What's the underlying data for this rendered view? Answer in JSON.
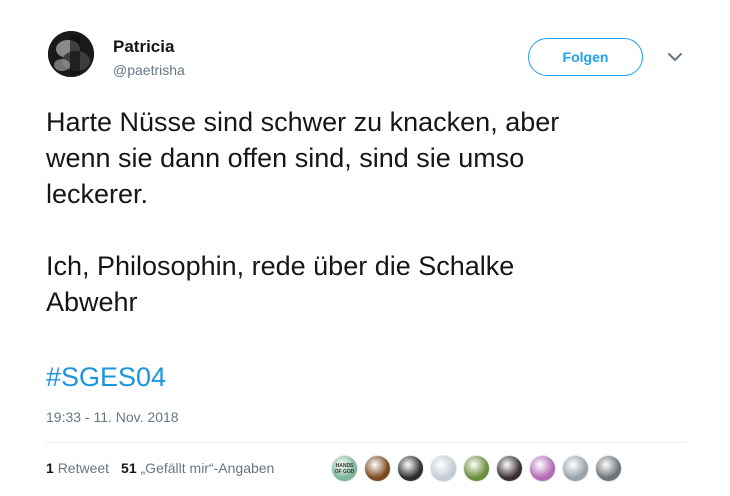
{
  "user": {
    "name": "Patricia",
    "handle": "@paetrisha"
  },
  "follow_label": "Folgen",
  "tweet": {
    "text": "Harte Nüsse sind schwer zu knacken, aber\nwenn sie dann offen sind, sind sie umso\nleckerer.\n\nIch, Philosophin, rede über die Schalke\nAbwehr",
    "hashtag": "#SGES04",
    "timestamp": "19:33 - 11. Nov. 2018"
  },
  "stats": {
    "retweets_count": "1",
    "retweets_label": "Retweet",
    "likes_count": "51",
    "likes_label": "„Gefällt mir“-Angaben"
  },
  "likers": [
    {
      "icon": "hands-of-god-avatar",
      "text": "HANDS OF GOD",
      "color": "#7fb59a"
    },
    {
      "icon": "lion-avatar",
      "text": "",
      "color": "#7a4a1e"
    },
    {
      "icon": "dark-portrait-avatar",
      "text": "",
      "color": "#2e2e2e"
    },
    {
      "icon": "default-profile-avatar",
      "text": "",
      "color": "#c4ccd3"
    },
    {
      "icon": "duck-avatar",
      "text": "",
      "color": "#6b8e3a"
    },
    {
      "icon": "eye-avatar",
      "text": "",
      "color": "#3a2f2f"
    },
    {
      "icon": "pink-portrait-avatar",
      "text": "",
      "color": "#b46bb4"
    },
    {
      "icon": "man-portrait-avatar",
      "text": "",
      "color": "#9aa3ab"
    },
    {
      "icon": "grey-sphere-avatar",
      "text": "",
      "color": "#6f7378"
    }
  ],
  "colors": {
    "accent": "#1da1f2",
    "hashtag": "#1b95e0",
    "secondary_text": "#657786"
  }
}
